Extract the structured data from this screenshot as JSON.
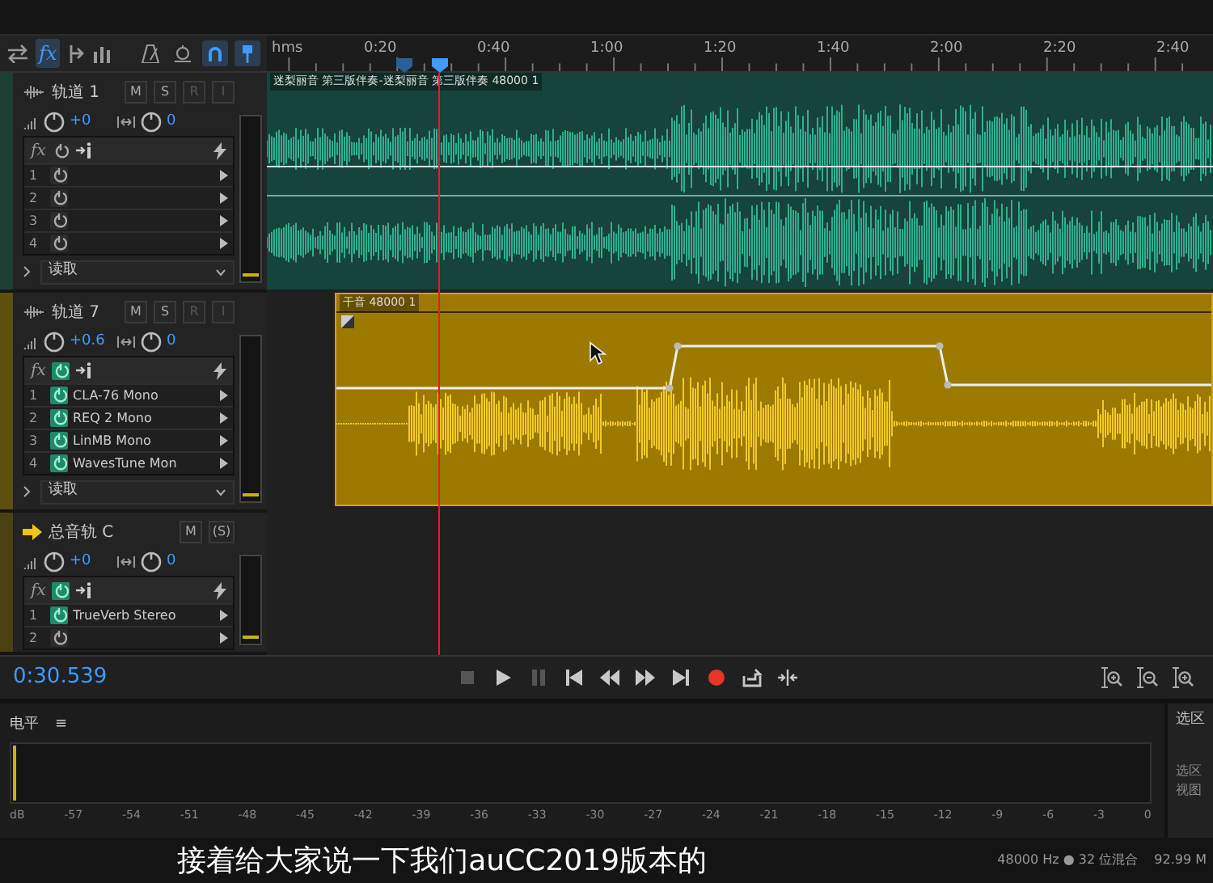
{
  "toolbar": {
    "fx": {
      "label": "fx",
      "selected": true
    },
    "tools": [
      {
        "kind": "metronome",
        "selected": false
      },
      {
        "kind": "monitor",
        "selected": false
      },
      {
        "kind": "snap",
        "selected": true
      },
      {
        "kind": "pin",
        "selected": true
      }
    ]
  },
  "ruler": {
    "unit": "hms",
    "labels": [
      "0:20",
      "0:40",
      "1:00",
      "1:20",
      "1:40",
      "2:00",
      "2:20",
      "2:40"
    ]
  },
  "tracks": [
    {
      "kind": "audio",
      "name": "轨道 1",
      "color": "#1d3f36",
      "volume": "+0",
      "pan": "0",
      "buttons": [
        {
          "label": "M",
          "disabled": false
        },
        {
          "label": "S",
          "disabled": false
        },
        {
          "label": "R",
          "disabled": true
        },
        {
          "label": "I",
          "disabled": true
        }
      ],
      "fx_label": "fx",
      "fx_on": false,
      "effects": [
        {
          "number": "1",
          "on": false
        },
        {
          "number": "2",
          "on": false
        },
        {
          "number": "3",
          "on": false
        },
        {
          "number": "4",
          "on": false
        }
      ],
      "automation": "读取",
      "clip": {
        "kind": "stereo",
        "title": "迷梨丽音 第三版伴奏-迷梨丽音 第三版伴奏 48000 1"
      }
    },
    {
      "kind": "audio",
      "name": "轨道 7",
      "color": "#5c4f0f",
      "volume": "+0.6",
      "pan": "0",
      "buttons": [
        {
          "label": "M",
          "disabled": false
        },
        {
          "label": "S",
          "disabled": false
        },
        {
          "label": "R",
          "disabled": true
        },
        {
          "label": "I",
          "disabled": true
        }
      ],
      "fx_label": "fx",
      "fx_on": true,
      "effects": [
        {
          "number": "1",
          "name": "CLA-76 Mono",
          "on": true
        },
        {
          "number": "2",
          "name": "REQ 2 Mono",
          "on": true
        },
        {
          "number": "3",
          "name": "LinMB Mono",
          "on": true
        },
        {
          "number": "4",
          "name": "WavesTune Mon",
          "on": true
        }
      ],
      "automation": "读取",
      "clip": {
        "kind": "mono",
        "title": "干音 48000 1"
      }
    },
    {
      "kind": "master",
      "name": "总音轨 C",
      "color": "#4a4212",
      "volume": "+0",
      "pan": "0",
      "buttons": [
        {
          "label": "M",
          "disabled": false
        },
        {
          "label": "(S)",
          "disabled": false
        }
      ],
      "fx_label": "fx",
      "fx_on": true,
      "effects": [
        {
          "number": "1",
          "name": "TrueVerb Stereo",
          "on": true
        },
        {
          "number": "2",
          "on": false
        }
      ]
    }
  ],
  "transport": {
    "time": "0:30.539",
    "buttons": [
      {
        "kind": "stop",
        "disabled": true
      },
      {
        "kind": "play",
        "disabled": false
      },
      {
        "kind": "pause",
        "disabled": true
      },
      {
        "kind": "to-start",
        "disabled": false
      },
      {
        "kind": "rewind",
        "disabled": false
      },
      {
        "kind": "forward",
        "disabled": false
      },
      {
        "kind": "to-end",
        "disabled": false
      },
      {
        "kind": "record",
        "disabled": false
      },
      {
        "kind": "loop",
        "disabled": false
      },
      {
        "kind": "skip",
        "disabled": false
      }
    ]
  },
  "levels": {
    "title": "电平",
    "menu": "≡",
    "scale": [
      "dB",
      "-57",
      "-54",
      "-51",
      "-48",
      "-45",
      "-42",
      "-39",
      "-36",
      "-33",
      "-30",
      "-27",
      "-24",
      "-21",
      "-18",
      "-15",
      "-12",
      "-9",
      "-6",
      "-3",
      "0"
    ]
  },
  "side_panel": {
    "title": "选区",
    "labels": [
      "选区",
      "视图"
    ]
  },
  "caption": "接着给大家说一下我们auCC2019版本的",
  "status_bar": {
    "sample_info": "48000 Hz ● 32 位混合",
    "memory": "92.99 M"
  }
}
